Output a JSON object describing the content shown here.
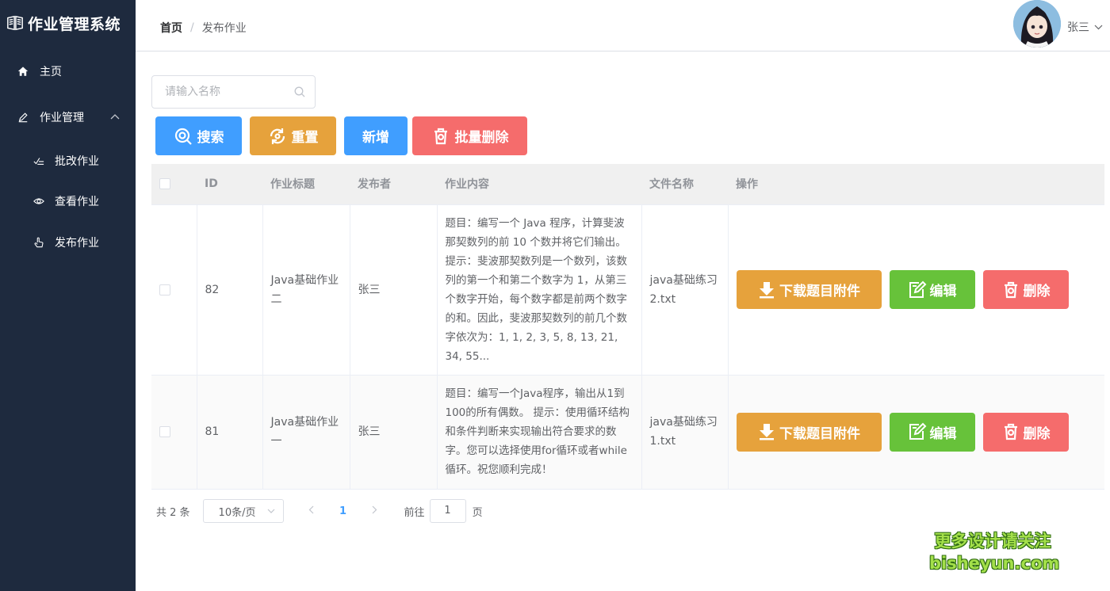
{
  "app": {
    "title": "作业管理系统"
  },
  "sidebar": {
    "items": [
      {
        "label": "主页",
        "icon": "home-icon"
      },
      {
        "label": "作业管理",
        "icon": "pencil-icon",
        "expanded": true
      },
      {
        "label": "批改作业",
        "icon": "grade-icon"
      },
      {
        "label": "查看作业",
        "icon": "eye-icon"
      },
      {
        "label": "发布作业",
        "icon": "hand-pointer-icon"
      }
    ]
  },
  "header": {
    "breadcrumb": {
      "home": "首页",
      "separator": "/",
      "current": "发布作业"
    },
    "user": {
      "name": "张三"
    }
  },
  "search": {
    "placeholder": "请输入名称",
    "value": ""
  },
  "toolbar": {
    "search_label": "搜索",
    "reset_label": "重置",
    "add_label": "新增",
    "batch_delete_label": "批量删除"
  },
  "colors": {
    "primary": "#409eff",
    "warning": "#e6a23c",
    "danger": "#f56c6c",
    "success": "#67c23a",
    "sidebar_bg": "#1e2a3e"
  },
  "table": {
    "columns": [
      "ID",
      "作业标题",
      "发布者",
      "作业内容",
      "文件名称",
      "操作"
    ],
    "rows": [
      {
        "id": "82",
        "title": "Java基础作业二",
        "publisher": "张三",
        "content": "题目：编写一个 Java 程序，计算斐波那契数列的前 10 个数并将它们输出。 提示：斐波那契数列是一个数列，该数列的第一个和第二个数字为 1，从第三个数字开始，每个数字都是前两个数字的和。因此，斐波那契数列的前几个数字依次为：1, 1, 2, 3, 5, 8, 13, 21, 34, 55...",
        "file": "java基础练习2.txt"
      },
      {
        "id": "81",
        "title": "Java基础作业一",
        "publisher": "张三",
        "content": "题目：编写一个Java程序，输出从1到100的所有偶数。 提示：使用循环结构和条件判断来实现输出符合要求的数字。您可以选择使用for循环或者while循环。祝您顺利完成！",
        "file": "java基础练习1.txt"
      }
    ],
    "actions": {
      "download": "下载题目附件",
      "edit": "编辑",
      "delete": "删除"
    }
  },
  "pagination": {
    "total": "共 2 条",
    "page_size": "10条/页",
    "current_page": "1",
    "goto_label": "前往",
    "goto_value": "1",
    "page_suffix": "页"
  },
  "watermark": {
    "line1": "更多设计请关注",
    "line2": "bisheyun.com"
  }
}
